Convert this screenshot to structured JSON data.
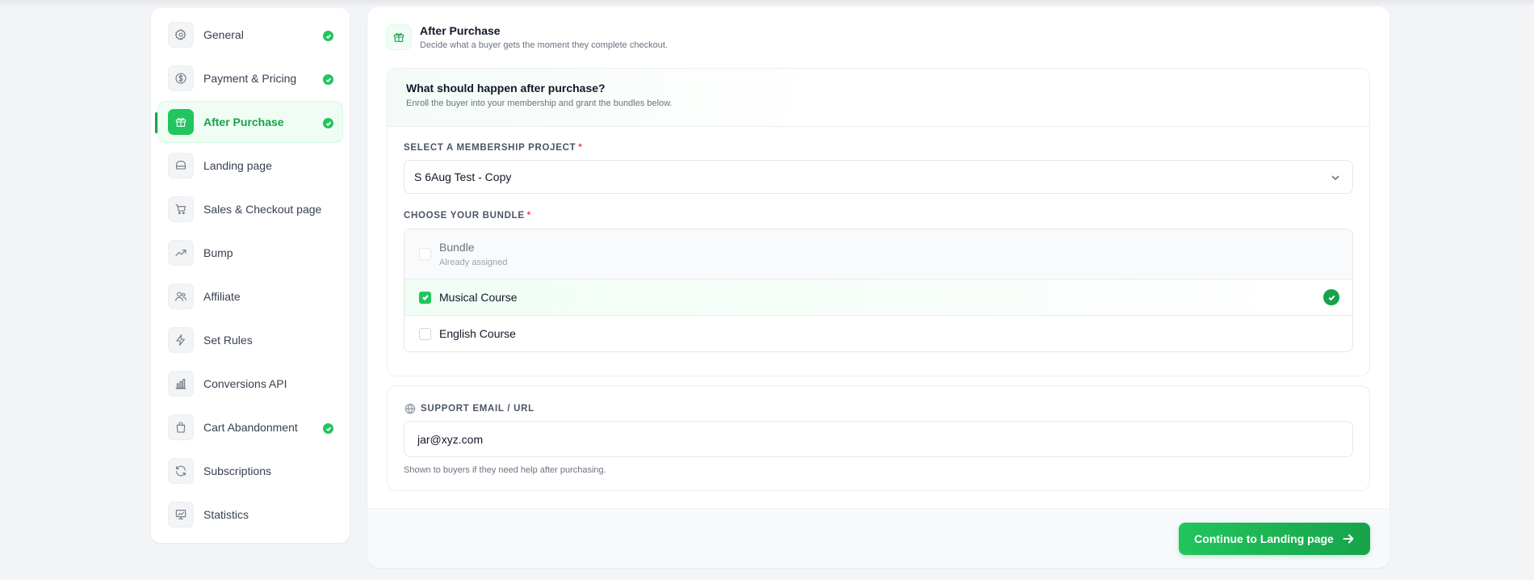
{
  "sidebar": {
    "items": [
      {
        "label": "General",
        "icon": "gear-icon",
        "completed": true,
        "active": false
      },
      {
        "label": "Payment & Pricing",
        "icon": "dollar-icon",
        "completed": true,
        "active": false
      },
      {
        "label": "After Purchase",
        "icon": "gift-icon",
        "completed": true,
        "active": true
      },
      {
        "label": "Landing page",
        "icon": "landing-icon",
        "completed": false,
        "active": false
      },
      {
        "label": "Sales & Checkout page",
        "icon": "cart-icon",
        "completed": false,
        "active": false
      },
      {
        "label": "Bump",
        "icon": "trending-up-icon",
        "completed": false,
        "active": false
      },
      {
        "label": "Affiliate",
        "icon": "users-icon",
        "completed": false,
        "active": false
      },
      {
        "label": "Set Rules",
        "icon": "lightning-icon",
        "completed": false,
        "active": false
      },
      {
        "label": "Conversions API",
        "icon": "bar-chart-icon",
        "completed": false,
        "active": false
      },
      {
        "label": "Cart Abandonment",
        "icon": "bag-icon",
        "completed": true,
        "active": false
      },
      {
        "label": "Subscriptions",
        "icon": "refresh-icon",
        "completed": false,
        "active": false
      },
      {
        "label": "Statistics",
        "icon": "presentation-chart-icon",
        "completed": false,
        "active": false
      }
    ]
  },
  "header": {
    "title": "After Purchase",
    "subtitle": "Decide what a buyer gets the moment they complete checkout.",
    "icon": "gift-icon"
  },
  "purchase_card": {
    "title": "What should happen after purchase?",
    "subtitle": "Enroll the buyer into your membership and grant the bundles below.",
    "project_label": "SELECT A MEMBERSHIP PROJECT",
    "required_mark": "*",
    "project_value": "S 6Aug Test - Copy",
    "bundle_label": "CHOOSE YOUR BUNDLE",
    "bundles": [
      {
        "name": "Bundle",
        "note": "Already assigned",
        "checked": false,
        "disabled": true
      },
      {
        "name": "Musical Course",
        "note": "",
        "checked": true,
        "disabled": false
      },
      {
        "name": "English Course",
        "note": "",
        "checked": false,
        "disabled": false
      }
    ]
  },
  "support": {
    "label": "SUPPORT EMAIL / URL",
    "value": "jar@xyz.com",
    "help": "Shown to buyers if they need help after purchasing.",
    "icon": "globe-icon"
  },
  "footer": {
    "continue_label": "Continue to Landing page",
    "continue_icon": "arrow-right-icon"
  },
  "colors": {
    "accent": "#22c55e",
    "accent_dark": "#16a34a",
    "required": "#ef4444"
  }
}
